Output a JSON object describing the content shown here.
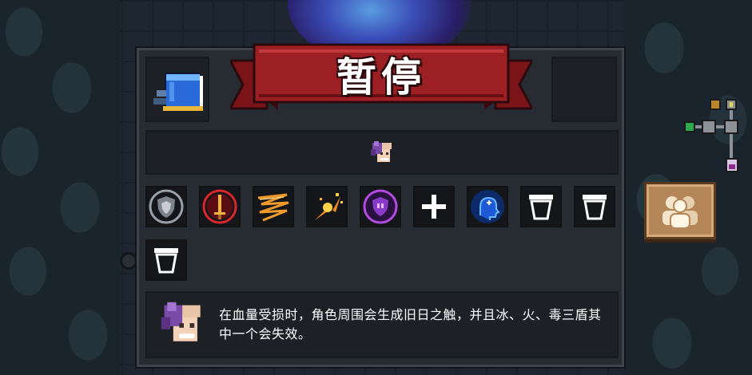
{
  "pause": {
    "title": "暂停",
    "description": "在血量受损时，角色周围会生成旧日之触，并且冰、火、毒三盾其中一个会失效。"
  },
  "weapon": {
    "icon": "blue-cube-weapon-icon"
  },
  "avatar": {
    "icon": "purple-tentacle-hair-character-icon"
  },
  "skills": [
    {
      "icon": "grey-shield-buff-icon"
    },
    {
      "icon": "red-sword-buff-icon"
    },
    {
      "icon": "orange-lightning-buff-icon"
    },
    {
      "icon": "fire-explosion-buff-icon"
    },
    {
      "icon": "purple-poison-shield-buff-icon"
    },
    {
      "icon": "plus-icon"
    },
    {
      "icon": "blue-mind-buff-icon"
    },
    {
      "icon": "empty-cup-slot-icon"
    },
    {
      "icon": "empty-cup-slot-icon"
    },
    {
      "icon": "empty-cup-slot-icon"
    }
  ],
  "minimap": {
    "icon": "dungeon-minimap"
  },
  "friends_button": {
    "icon": "multiplayer-friends-icon"
  },
  "colors": {
    "banner_red": "#9c1f24",
    "banner_dark": "#5c0d12",
    "panel_bg": "#272c33",
    "button_tan": "#b48658"
  }
}
